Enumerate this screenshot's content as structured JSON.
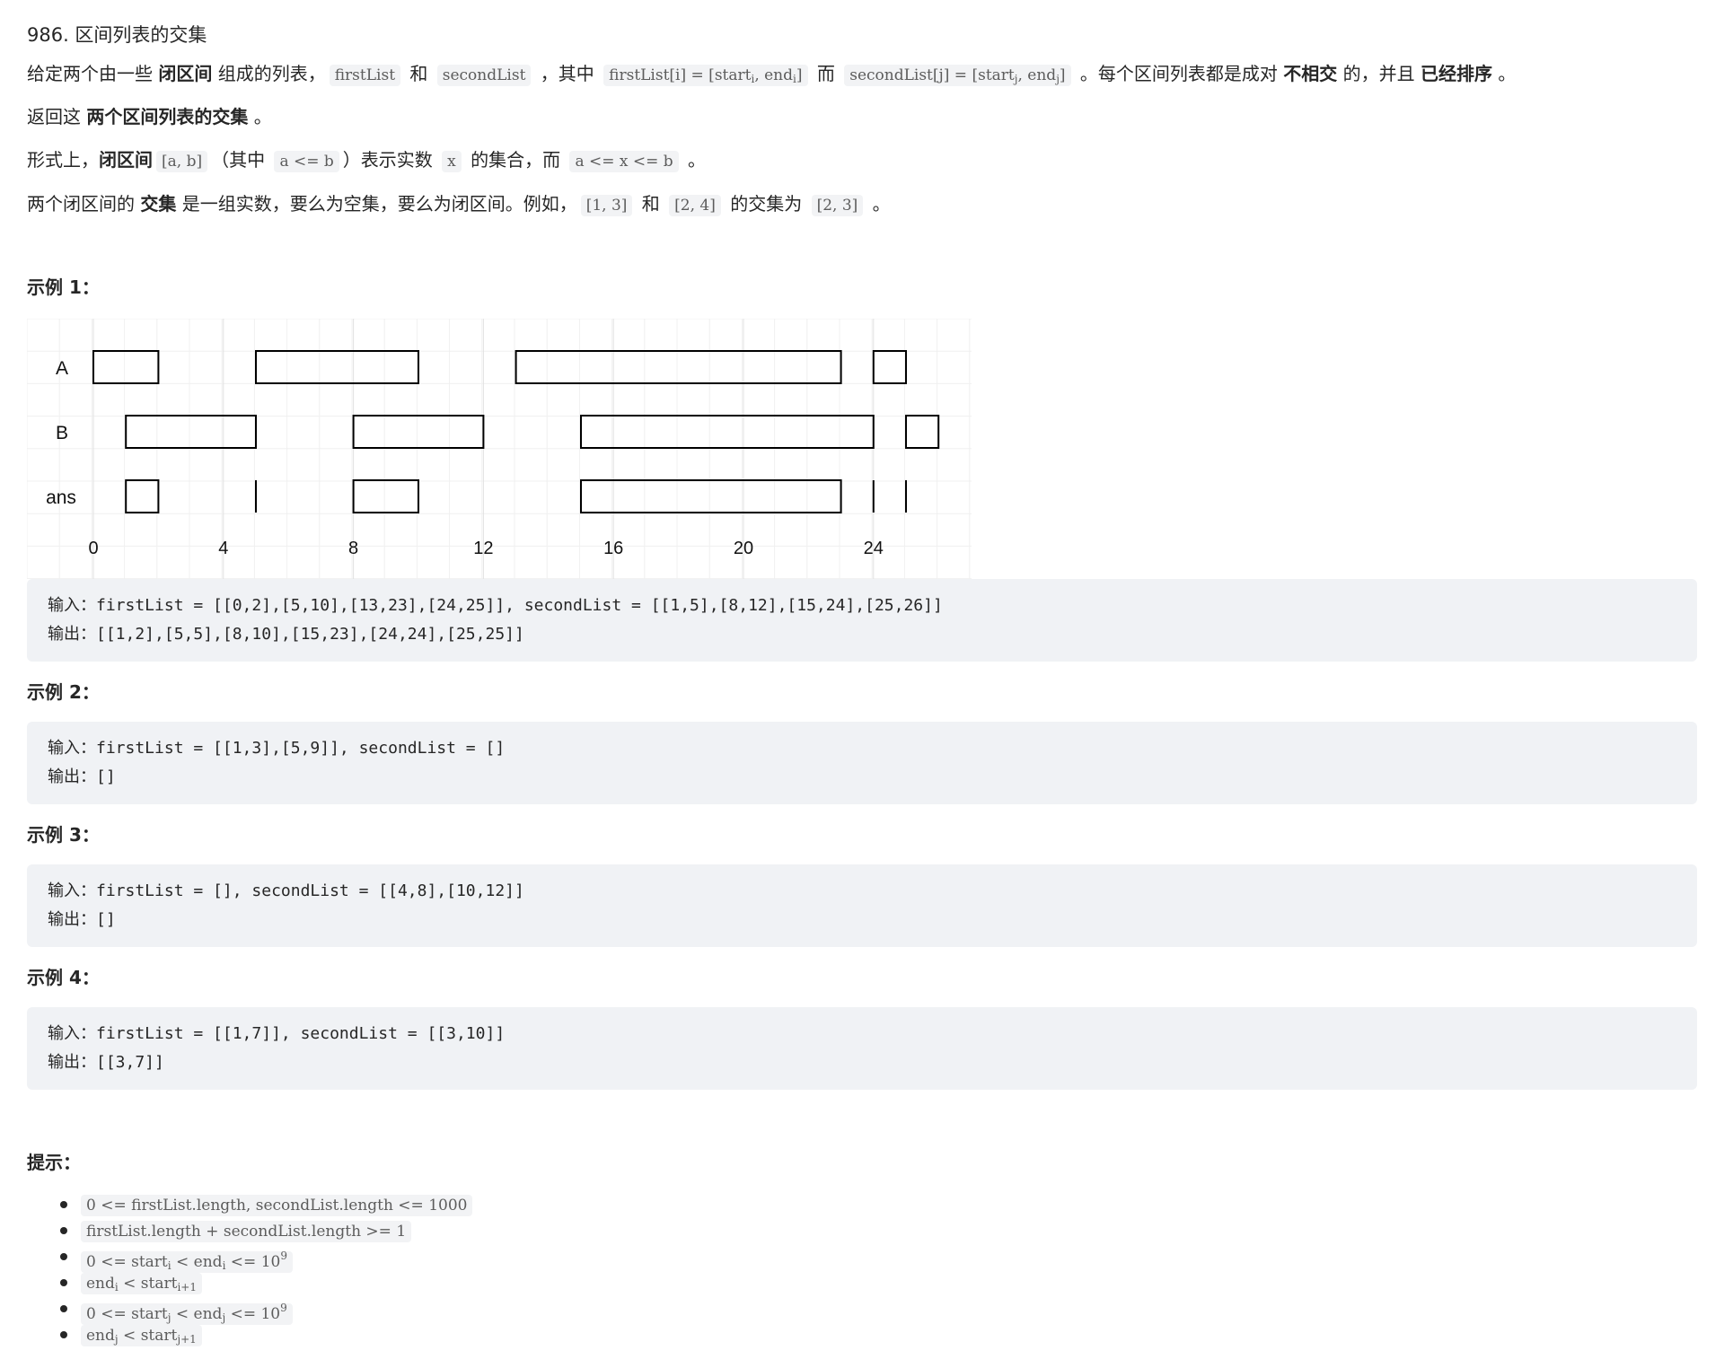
{
  "problem": {
    "title": "986. 区间列表的交集"
  },
  "description": {
    "p1": {
      "t1": "给定两个由一些 ",
      "b1": "闭区间",
      "t2": " 组成的列表，",
      "c1": "firstList",
      "t3": " 和 ",
      "c2": "secondList",
      "t4": " ，其中 ",
      "c3a": "firstList[i] = [start",
      "c3s1": "i",
      "c3b": ", end",
      "c3s2": "i",
      "c3c": "]",
      "t5": " 而 ",
      "c4a": "secondList[j] = [start",
      "c4s1": "j",
      "c4b": ", end",
      "c4s2": "j",
      "c4c": "]",
      "t6": " 。每个区间列表都是成对 ",
      "b2": "不相交",
      "t7": " 的，并且 ",
      "b3": "已经排序",
      "t8": " 。"
    },
    "p2": {
      "t1": "返回这 ",
      "b1": "两个区间列表的交集",
      "t2": " 。"
    },
    "p3": {
      "t1": "形式上，",
      "b1": "闭区间",
      "c1": "[a, b]",
      "t2": "（其中 ",
      "c2": "a <= b",
      "t3": "）表示实数 ",
      "c3": "x",
      "t4": " 的集合，而 ",
      "c4": "a <= x <= b",
      "t5": " 。"
    },
    "p4": {
      "t1": "两个闭区间的 ",
      "b1": "交集",
      "t2": " 是一组实数，要么为空集，要么为闭区间。例如，",
      "c1": "[1, 3]",
      "t3": " 和 ",
      "c2": "[2, 4]",
      "t4": " 的交集为 ",
      "c3": "[2, 3]",
      "t5": " 。"
    }
  },
  "examples": [
    {
      "heading": "示例 1：",
      "input": "输入：firstList = [[0,2],[5,10],[13,23],[24,25]], secondList = [[1,5],[8,12],[15,24],[25,26]]",
      "output": "输出：[[1,2],[5,5],[8,10],[15,23],[24,24],[25,25]]"
    },
    {
      "heading": "示例 2：",
      "input": "输入：firstList = [[1,3],[5,9]], secondList = []",
      "output": "输出：[]"
    },
    {
      "heading": "示例 3：",
      "input": "输入：firstList = [], secondList = [[4,8],[10,12]]",
      "output": "输出：[]"
    },
    {
      "heading": "示例 4：",
      "input": "输入：firstList = [[1,7]], secondList = [[3,10]]",
      "output": "输出：[[3,7]]"
    }
  ],
  "diagram": {
    "row_labels": [
      "A",
      "B",
      "ans"
    ],
    "tick_labels": [
      "0",
      "4",
      "8",
      "12",
      "16",
      "20",
      "24"
    ],
    "A": [
      [
        0,
        2
      ],
      [
        5,
        10
      ],
      [
        13,
        23
      ],
      [
        24,
        25
      ]
    ],
    "B": [
      [
        1,
        5
      ],
      [
        8,
        12
      ],
      [
        15,
        24
      ],
      [
        25,
        26
      ]
    ],
    "ans": [
      [
        1,
        2
      ],
      [
        5,
        5
      ],
      [
        8,
        10
      ],
      [
        15,
        23
      ],
      [
        24,
        24
      ],
      [
        25,
        25
      ]
    ]
  },
  "hints": {
    "heading": "提示：",
    "h1": "0 <= firstList.length, secondList.length <= 1000",
    "h2": "firstList.length + secondList.length >= 1",
    "h3a": "0 <= start",
    "h3s1": "i",
    "h3b": " < end",
    "h3s2": "i",
    "h3c": " <= 10",
    "h3p": "9",
    "h4a": "end",
    "h4s1": "i",
    "h4b": " < start",
    "h4s2": "i+1",
    "h5a": "0 <= start",
    "h5s1": "j",
    "h5b": " < end",
    "h5s2": "j",
    "h5c": " <= 10",
    "h5p": "9",
    "h6a": "end",
    "h6s1": "j",
    "h6b": " < start",
    "h6s2": "j+1"
  }
}
